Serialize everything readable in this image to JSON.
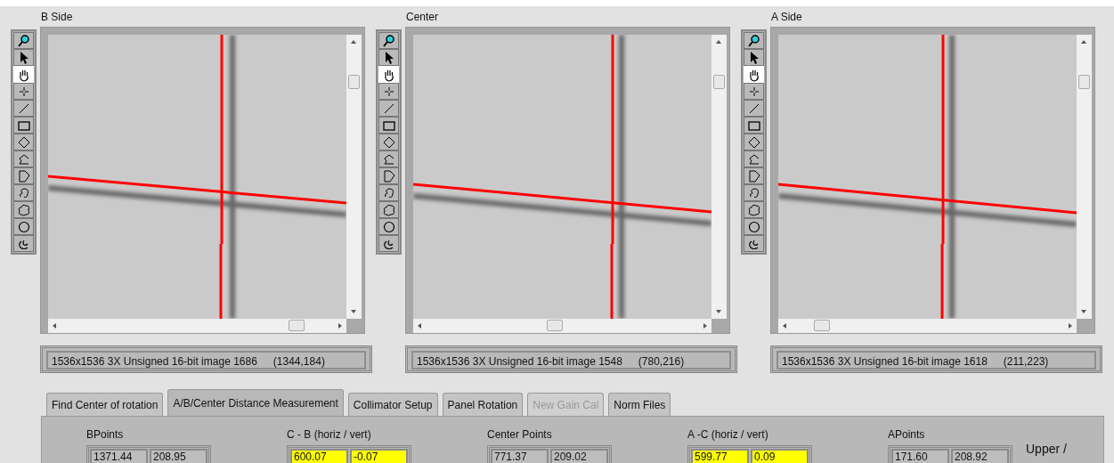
{
  "panels": [
    {
      "title": "B Side",
      "tools": [
        {
          "kind": "zoom",
          "selected": false
        },
        {
          "kind": "select",
          "selected": false
        },
        {
          "kind": "pan",
          "selected": true
        },
        {
          "kind": "point",
          "selected": false
        },
        {
          "kind": "line",
          "selected": false
        },
        {
          "kind": "rect",
          "selected": false
        },
        {
          "kind": "rotated_rect",
          "selected": false
        },
        {
          "kind": "polyline",
          "selected": false
        },
        {
          "kind": "polygon",
          "selected": false
        },
        {
          "kind": "freehand_line",
          "selected": false
        },
        {
          "kind": "freehand",
          "selected": false
        },
        {
          "kind": "oval",
          "selected": false
        },
        {
          "kind": "annulus",
          "selected": false
        }
      ],
      "image_info": "1536x1536 3X Unsigned 16-bit image 1686",
      "cursor": "(1344,184)"
    },
    {
      "title": "Center",
      "tools": [
        {
          "kind": "zoom",
          "selected": false
        },
        {
          "kind": "select",
          "selected": false
        },
        {
          "kind": "pan",
          "selected": true
        },
        {
          "kind": "point",
          "selected": false
        },
        {
          "kind": "line",
          "selected": false
        },
        {
          "kind": "rect",
          "selected": false
        },
        {
          "kind": "rotated_rect",
          "selected": false
        },
        {
          "kind": "polyline",
          "selected": false
        },
        {
          "kind": "polygon",
          "selected": false
        },
        {
          "kind": "freehand_line",
          "selected": false
        },
        {
          "kind": "freehand",
          "selected": false
        },
        {
          "kind": "oval",
          "selected": false
        },
        {
          "kind": "annulus",
          "selected": false
        }
      ],
      "image_info": "1536x1536 3X Unsigned 16-bit image 1548",
      "cursor": "(780,216)"
    },
    {
      "title": "A Side",
      "tools": [
        {
          "kind": "zoom",
          "selected": false
        },
        {
          "kind": "select",
          "selected": false
        },
        {
          "kind": "pan",
          "selected": true
        },
        {
          "kind": "point",
          "selected": false
        },
        {
          "kind": "line",
          "selected": false
        },
        {
          "kind": "rect",
          "selected": false
        },
        {
          "kind": "rotated_rect",
          "selected": false
        },
        {
          "kind": "polyline",
          "selected": false
        },
        {
          "kind": "polygon",
          "selected": false
        },
        {
          "kind": "freehand_line",
          "selected": false
        },
        {
          "kind": "freehand",
          "selected": false
        },
        {
          "kind": "oval",
          "selected": false
        },
        {
          "kind": "annulus",
          "selected": false
        }
      ],
      "image_info": "1536x1536 3X Unsigned 16-bit image 1618",
      "cursor": "(211,223)"
    }
  ],
  "tabs": [
    {
      "label": "Find Center of rotation",
      "selected": false,
      "disabled": false
    },
    {
      "label": "A/B/Center Distance Measurement",
      "selected": true,
      "disabled": false
    },
    {
      "label": "Collimator Setup",
      "selected": false,
      "disabled": false
    },
    {
      "label": "Panel Rotation",
      "selected": false,
      "disabled": false
    },
    {
      "label": "New Gain Cal",
      "selected": false,
      "disabled": true
    },
    {
      "label": "Norm Files",
      "selected": false,
      "disabled": false
    }
  ],
  "measurements": [
    {
      "label": "BPoints",
      "kind": "points",
      "values": [
        "1371.44",
        "208.95"
      ]
    },
    {
      "label": "C - B (horiz / vert)",
      "kind": "difference",
      "values": [
        "600.07",
        "-0.07"
      ]
    },
    {
      "label": "Center Points",
      "kind": "points",
      "values": [
        "771.37",
        "209.02"
      ]
    },
    {
      "label": "A -C (horiz / vert)",
      "kind": "difference",
      "values": [
        "599.77",
        "0.09"
      ]
    },
    {
      "label": "APoints",
      "kind": "points",
      "values": [
        "171.60",
        "208.92"
      ]
    }
  ],
  "side_label": "Upper /"
}
